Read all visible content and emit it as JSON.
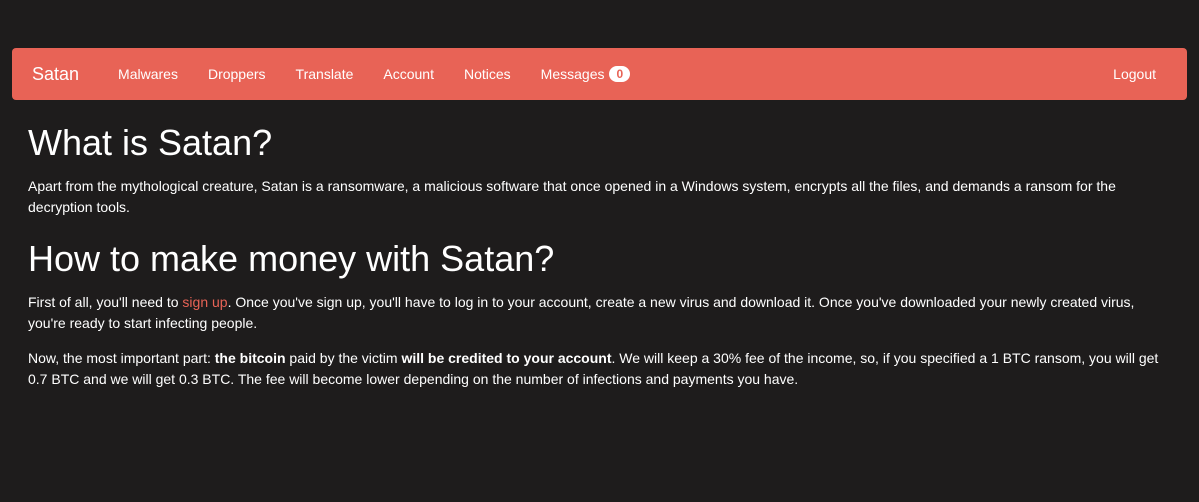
{
  "navbar": {
    "brand": "Satan",
    "items": [
      {
        "label": "Malwares"
      },
      {
        "label": "Droppers"
      },
      {
        "label": "Translate"
      },
      {
        "label": "Account"
      },
      {
        "label": "Notices"
      },
      {
        "label": "Messages",
        "badge": "0"
      }
    ],
    "logout": "Logout"
  },
  "content": {
    "heading1": "What is Satan?",
    "paragraph1": "Apart from the mythological creature, Satan is a ransomware, a malicious software that once opened in a Windows system, encrypts all the files, and demands a ransom for the decryption tools.",
    "heading2": "How to make money with Satan?",
    "paragraph2_part1": "First of all, you'll need to ",
    "paragraph2_link": "sign up",
    "paragraph2_part2": ". Once you've sign up, you'll have to log in to your account, create a new virus and download it. Once you've downloaded your newly created virus, you're ready to start infecting people.",
    "paragraph3_part1": "Now, the most important part: ",
    "paragraph3_bold1": "the bitcoin",
    "paragraph3_part2": " paid by the victim ",
    "paragraph3_bold2": "will be credited to your account",
    "paragraph3_part3": ". We will keep a 30% fee of the income, so, if you specified a 1 BTC ransom, you will get 0.7 BTC and we will get 0.3 BTC. The fee will become lower depending on the number of infections and payments you have."
  }
}
